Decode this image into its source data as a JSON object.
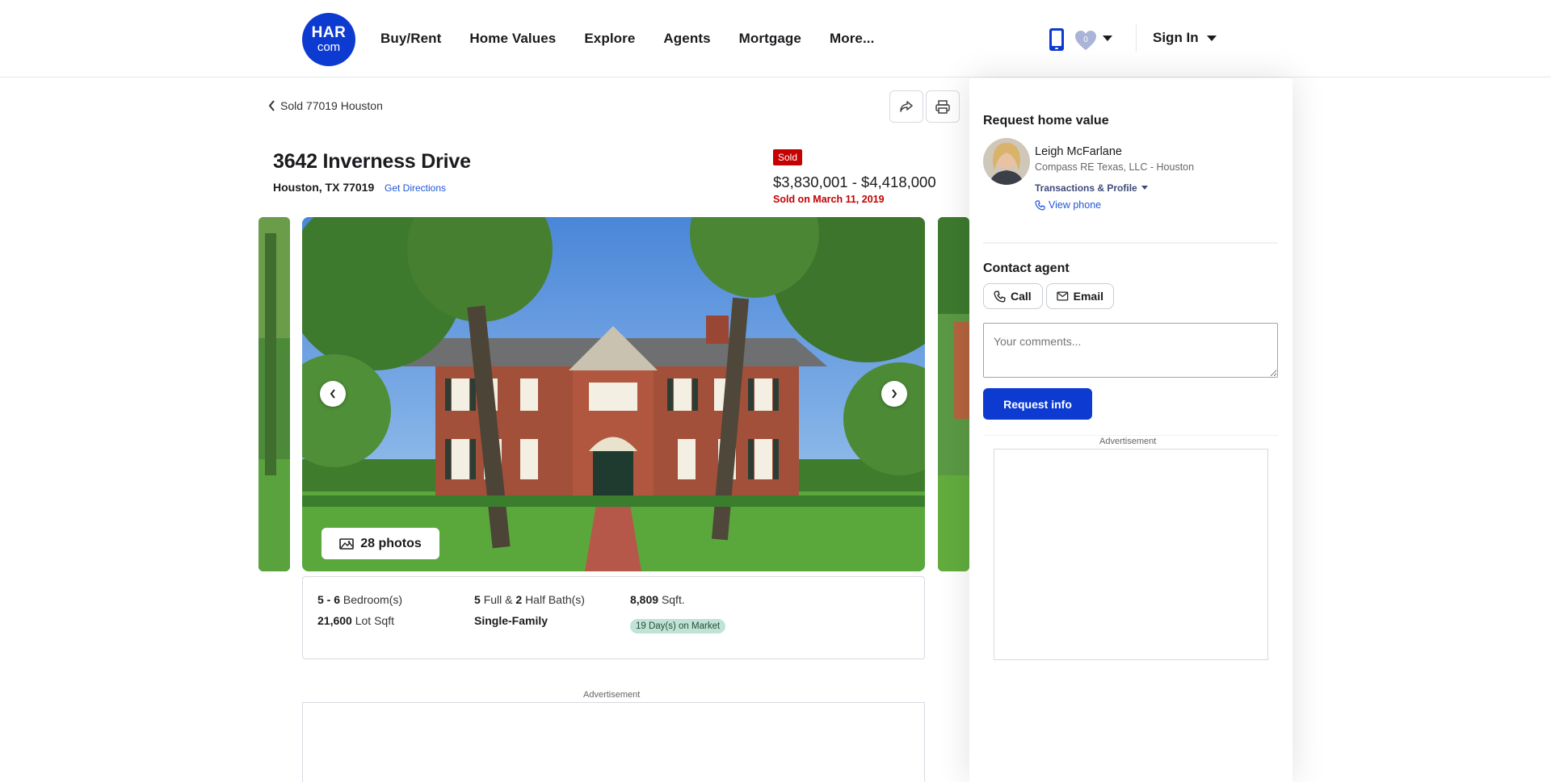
{
  "header": {
    "logo_top": "HAR",
    "logo_bottom": "com",
    "nav": [
      "Buy/Rent",
      "Home Values",
      "Explore",
      "Agents",
      "Mortgage",
      "More..."
    ],
    "favorites_count": "0",
    "sign_in": "Sign In"
  },
  "listing": {
    "breadcrumb": "Sold 77019 Houston",
    "title": "3642 Inverness Drive",
    "address": "Houston, TX 77019",
    "directions": "Get Directions",
    "status": "Sold",
    "price": "$3,830,001 - $4,418,000",
    "sold_date": "Sold on March 11, 2019",
    "photos_label": "28 photos",
    "facts": {
      "bedrooms_value": "5 - 6",
      "bedrooms_label": "Bedroom(s)",
      "full_bath_value": "5",
      "full_bath_label": "Full &",
      "half_bath_value": "2",
      "half_bath_label": "Half Bath(s)",
      "sqft_value": "8,809",
      "sqft_label": "Sqft.",
      "lot_value": "21,600",
      "lot_label": "Lot Sqft",
      "type": "Single-Family",
      "days_on_market": "19 Day(s) on Market"
    },
    "ad_label": "Advertisement"
  },
  "sidebar": {
    "request_heading": "Request home value",
    "agent_name": "Leigh McFarlane",
    "agent_company": "Compass RE Texas, LLC - Houston",
    "agent_link": "Transactions & Profile",
    "agent_phone": "View phone",
    "contact_heading": "Contact agent",
    "call_label": "Call",
    "email_label": "Email",
    "comments_placeholder": "Your comments...",
    "request_button": "Request info",
    "ad_label": "Advertisement"
  },
  "colors": {
    "brand_blue": "#0d3bd1",
    "sold_red": "#c40000",
    "link_blue": "#1f56d6",
    "dom_green": "#bfe3d4"
  },
  "icons": [
    "phone-icon",
    "heart-icon",
    "share-icon",
    "print-icon",
    "chevron-left-icon",
    "chevron-right-icon",
    "gallery-icon",
    "call-icon",
    "email-icon"
  ]
}
